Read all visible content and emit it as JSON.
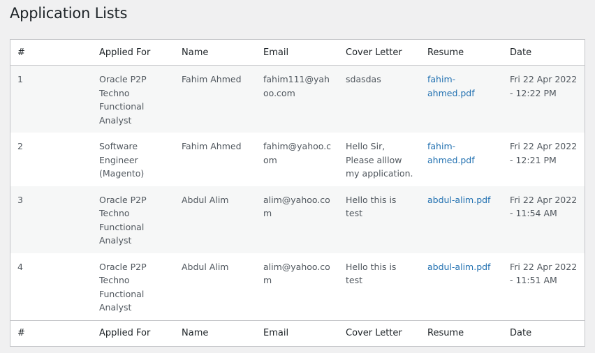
{
  "page": {
    "title": "Application Lists"
  },
  "table": {
    "columns": [
      "#",
      "Applied For",
      "Name",
      "Email",
      "Cover Letter",
      "Resume",
      "Date"
    ],
    "rows": [
      {
        "num": "1",
        "applied_for": "Oracle P2P Techno Functional Analyst",
        "name": "Fahim Ahmed",
        "email": "fahim111@yahoo.com",
        "cover_letter": "sdasdas",
        "resume": "fahim-ahmed.pdf",
        "date": "Fri 22 Apr 2022 - 12:22 PM"
      },
      {
        "num": "2",
        "applied_for": "Software Engineer (Magento)",
        "name": "Fahim Ahmed",
        "email": "fahim@yahoo.com",
        "cover_letter": "Hello Sir, Please alllow my application.",
        "resume": "fahim-ahmed.pdf",
        "date": "Fri 22 Apr 2022 - 12:21 PM"
      },
      {
        "num": "3",
        "applied_for": "Oracle P2P Techno Functional Analyst",
        "name": "Abdul Alim",
        "email": "alim@yahoo.com",
        "cover_letter": "Hello this is test",
        "resume": "abdul-alim.pdf",
        "date": "Fri 22 Apr 2022 - 11:54 AM"
      },
      {
        "num": "4",
        "applied_for": "Oracle P2P Techno Functional Analyst",
        "name": "Abdul Alim",
        "email": "alim@yahoo.com",
        "cover_letter": "Hello this is test",
        "resume": "abdul-alim.pdf",
        "date": "Fri 22 Apr 2022 - 11:51 AM"
      }
    ]
  },
  "colors": {
    "background": "#f0f0f1",
    "link": "#2271b1",
    "border": "#c3c4c7",
    "stripe": "#f6f7f7"
  }
}
